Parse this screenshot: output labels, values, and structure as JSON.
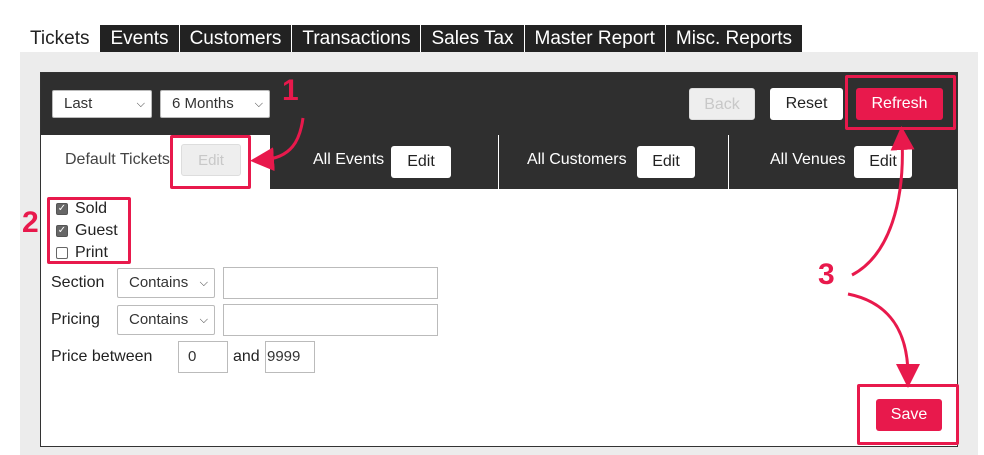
{
  "tabs": [
    {
      "label": "Tickets",
      "active": true
    },
    {
      "label": "Events"
    },
    {
      "label": "Customers"
    },
    {
      "label": "Transactions"
    },
    {
      "label": "Sales Tax"
    },
    {
      "label": "Master Report"
    },
    {
      "label": "Misc. Reports"
    }
  ],
  "toolbar": {
    "period_select": "Last",
    "range_select": "6 Months",
    "back_label": "Back",
    "reset_label": "Reset",
    "refresh_label": "Refresh"
  },
  "subtabs": [
    {
      "label": "Default Tickets",
      "edit": "Edit",
      "edit_disabled": true
    },
    {
      "label": "All Events",
      "edit": "Edit"
    },
    {
      "label": "All Customers",
      "edit": "Edit"
    },
    {
      "label": "All Venues",
      "edit": "Edit"
    }
  ],
  "filters": {
    "checkboxes": [
      {
        "label": "Sold",
        "checked": true
      },
      {
        "label": "Guest",
        "checked": true
      },
      {
        "label": "Print",
        "checked": false
      }
    ],
    "section_label": "Section",
    "section_op": "Contains",
    "section_value": "",
    "pricing_label": "Pricing",
    "pricing_op": "Contains",
    "pricing_value": "",
    "price_between_label": "Price between",
    "price_min": "0",
    "and_label": "and",
    "price_max": "9999"
  },
  "save_label": "Save",
  "annotations": {
    "step1": "1",
    "step2": "2",
    "step3": "3"
  },
  "colors": {
    "accent": "#e8194c",
    "dark": "#2f2f2f"
  },
  "icons": {
    "dropdown": "chevron-down-icon",
    "check": "checkmark-icon"
  }
}
